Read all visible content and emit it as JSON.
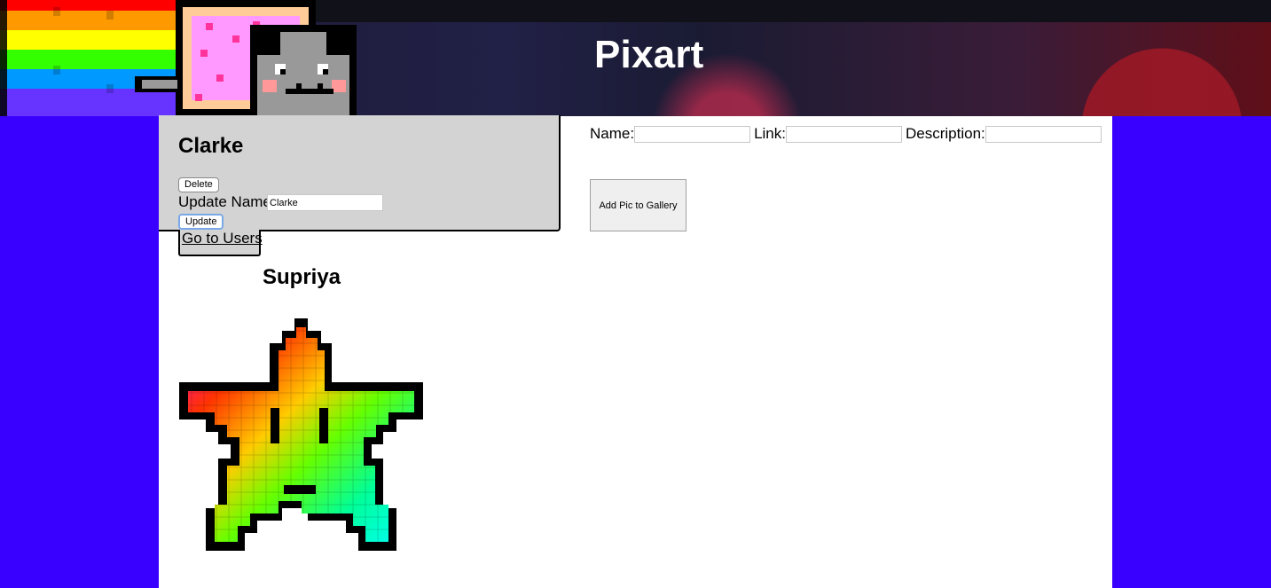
{
  "header": {
    "title": "Pixart"
  },
  "user_card": {
    "name": "Clarke",
    "delete_label": "Delete",
    "update_name_label": "Update Name",
    "update_input_value": "Clarke",
    "update_label": "Update",
    "go_to_users_label": "Go to Users"
  },
  "gallery": {
    "artist_name": "Supriya",
    "image_icon": "rainbow-pixel-star"
  },
  "add_form": {
    "name_label": "Name:",
    "name_value": "",
    "link_label": "Link:",
    "link_value": "",
    "description_label": "Description:",
    "description_value": "",
    "submit_label": "Add Pic to Gallery"
  },
  "colors": {
    "page_background": "#3a00ff",
    "card_background": "#d3d3d3",
    "content_background": "#ffffff"
  }
}
